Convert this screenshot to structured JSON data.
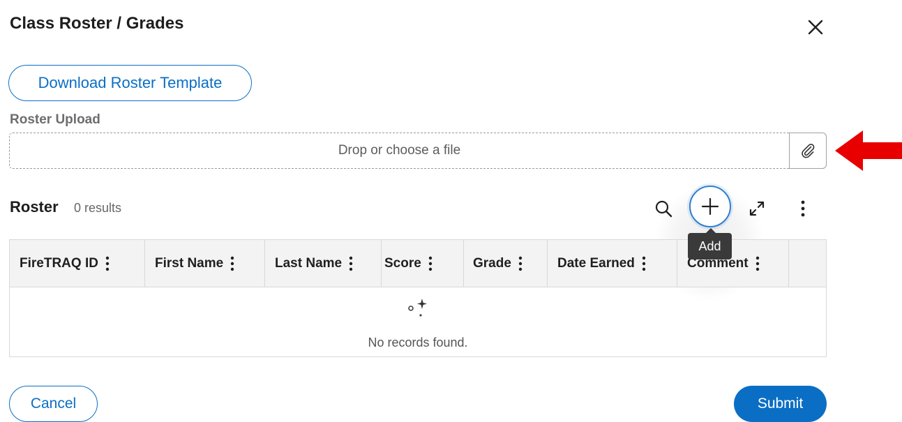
{
  "dialog": {
    "title": "Class Roster / Grades",
    "close_icon": "close-icon"
  },
  "template": {
    "download_label": "Download Roster Template"
  },
  "upload": {
    "label": "Roster Upload",
    "placeholder": "Drop or choose a file",
    "attach_icon": "paperclip-icon"
  },
  "annotation": {
    "arrow_color": "#e80000"
  },
  "roster": {
    "title": "Roster",
    "count": "0 results",
    "toolbar": {
      "search_icon": "search-icon",
      "add_icon": "plus-icon",
      "expand_icon": "expand-icon",
      "more_icon": "more-vertical-icon",
      "add_tooltip": "Add"
    },
    "columns": [
      {
        "label": "FireTRAQ ID"
      },
      {
        "label": "First Name"
      },
      {
        "label": "Last Name"
      },
      {
        "label": "Score"
      },
      {
        "label": "Grade"
      },
      {
        "label": "Date Earned"
      },
      {
        "label": "Comment"
      }
    ],
    "empty_text": "No records found."
  },
  "footer": {
    "cancel_label": "Cancel",
    "submit_label": "Submit"
  },
  "colors": {
    "accent": "#0b6ec5",
    "header_bg": "#f3f3f3",
    "tooltip_bg": "#3a3a3a"
  }
}
